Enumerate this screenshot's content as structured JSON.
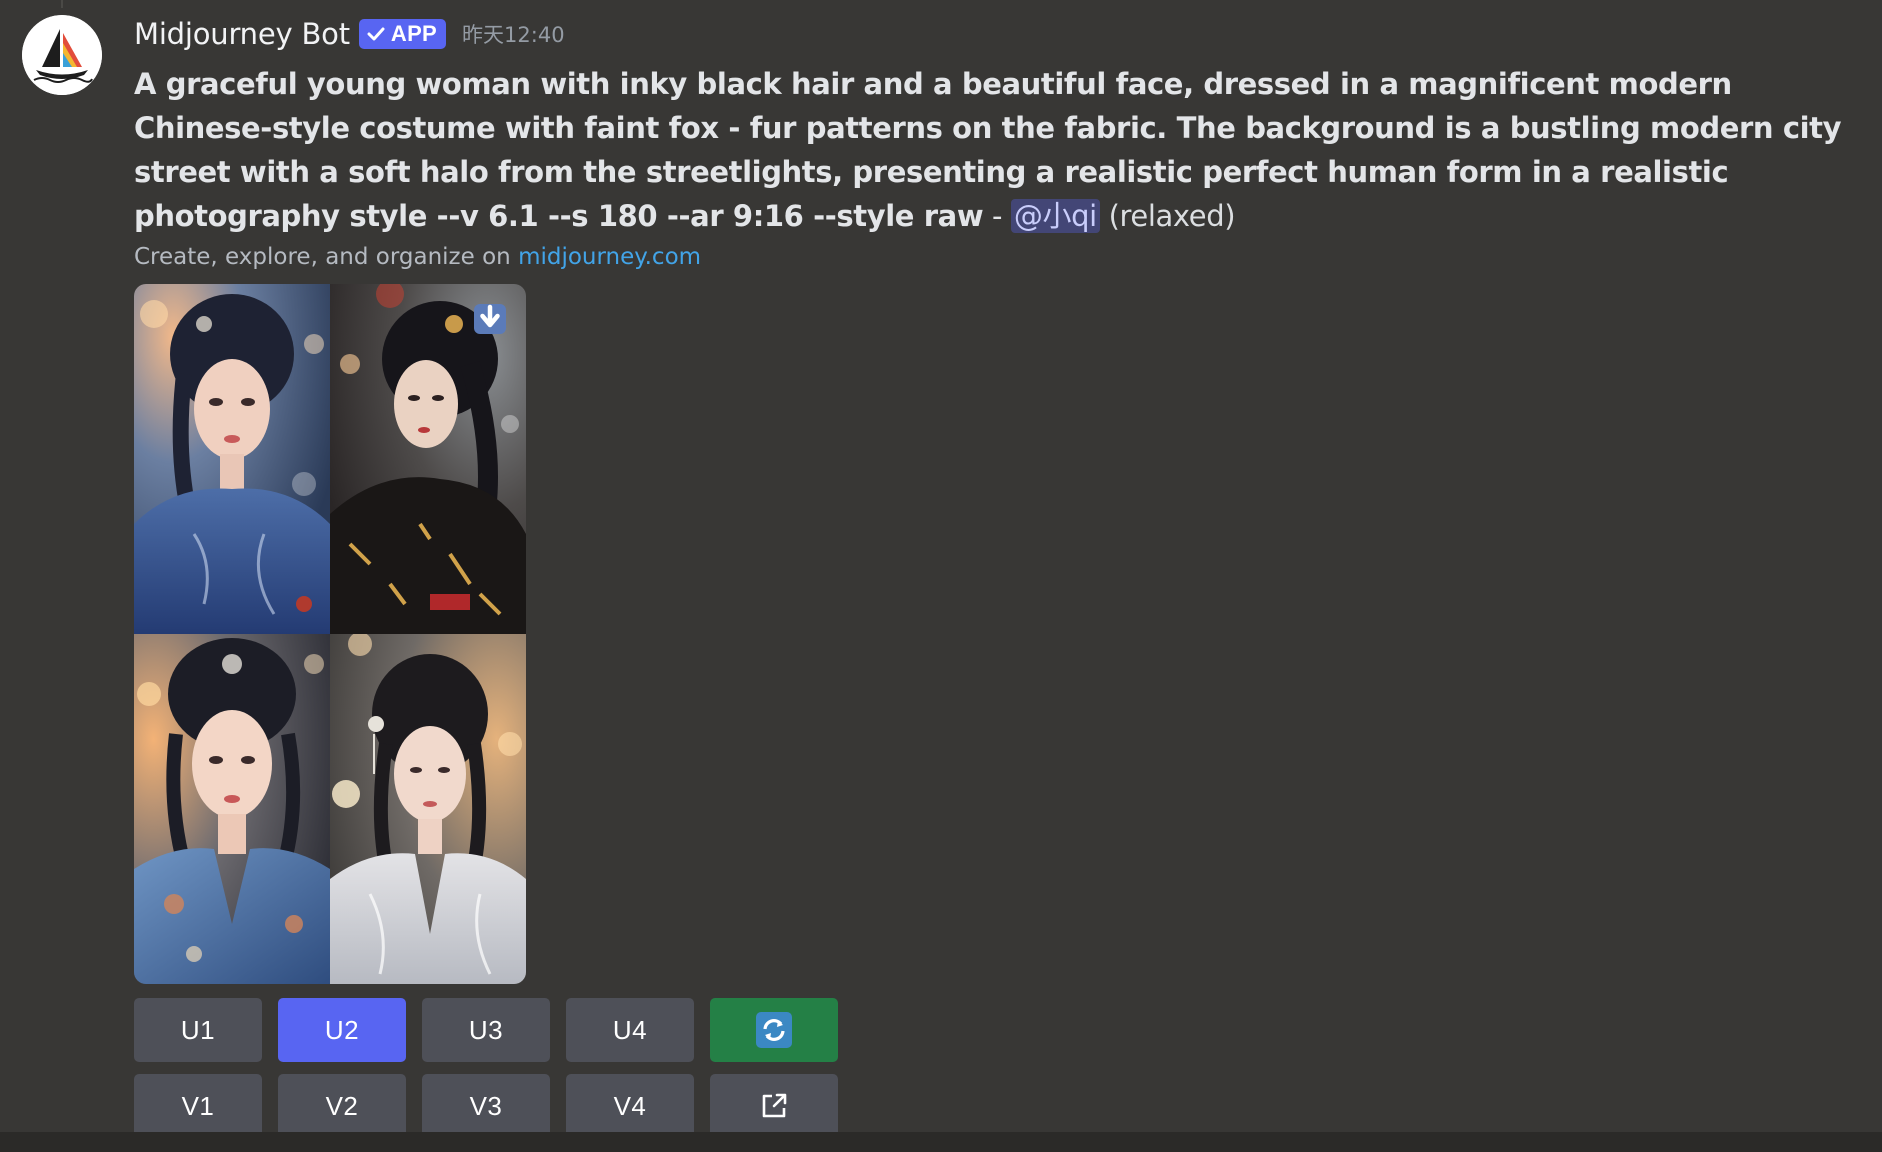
{
  "message": {
    "author": "Midjourney Bot",
    "badge": "APP",
    "timestamp": "昨天12:40",
    "prompt_bold": "A graceful young woman with inky black hair and a beautiful face, dressed in a magnificent modern Chinese-style costume with faint fox - fur patterns on the fabric. The background is a bustling modern city street with a soft halo from the streetlights, presenting a realistic perfect human form in a realistic photography style --v 6.1 --s 180 --ar 9:16 --style raw",
    "prompt_sep": " - ",
    "mention": "@小qi",
    "mode": "(relaxed)",
    "footer_text": "Create, explore, and organize on ",
    "footer_link": "midjourney.com"
  },
  "images": [
    {
      "name": "image-1",
      "dress": "blue-floral"
    },
    {
      "name": "image-2",
      "dress": "black-gold"
    },
    {
      "name": "image-3",
      "dress": "blue-floral"
    },
    {
      "name": "image-4",
      "dress": "white-silk"
    }
  ],
  "buttons": {
    "upscale": [
      "U1",
      "U2",
      "U3",
      "U4"
    ],
    "variation": [
      "V1",
      "V2",
      "V3",
      "V4"
    ],
    "active": "U2",
    "reroll_icon": "refresh-icon",
    "web_icon": "external-link-icon"
  },
  "colors": {
    "background": "#383735",
    "blurple": "#5865f2",
    "button": "#4e5058",
    "green": "#248046",
    "link": "#42a4e8"
  }
}
